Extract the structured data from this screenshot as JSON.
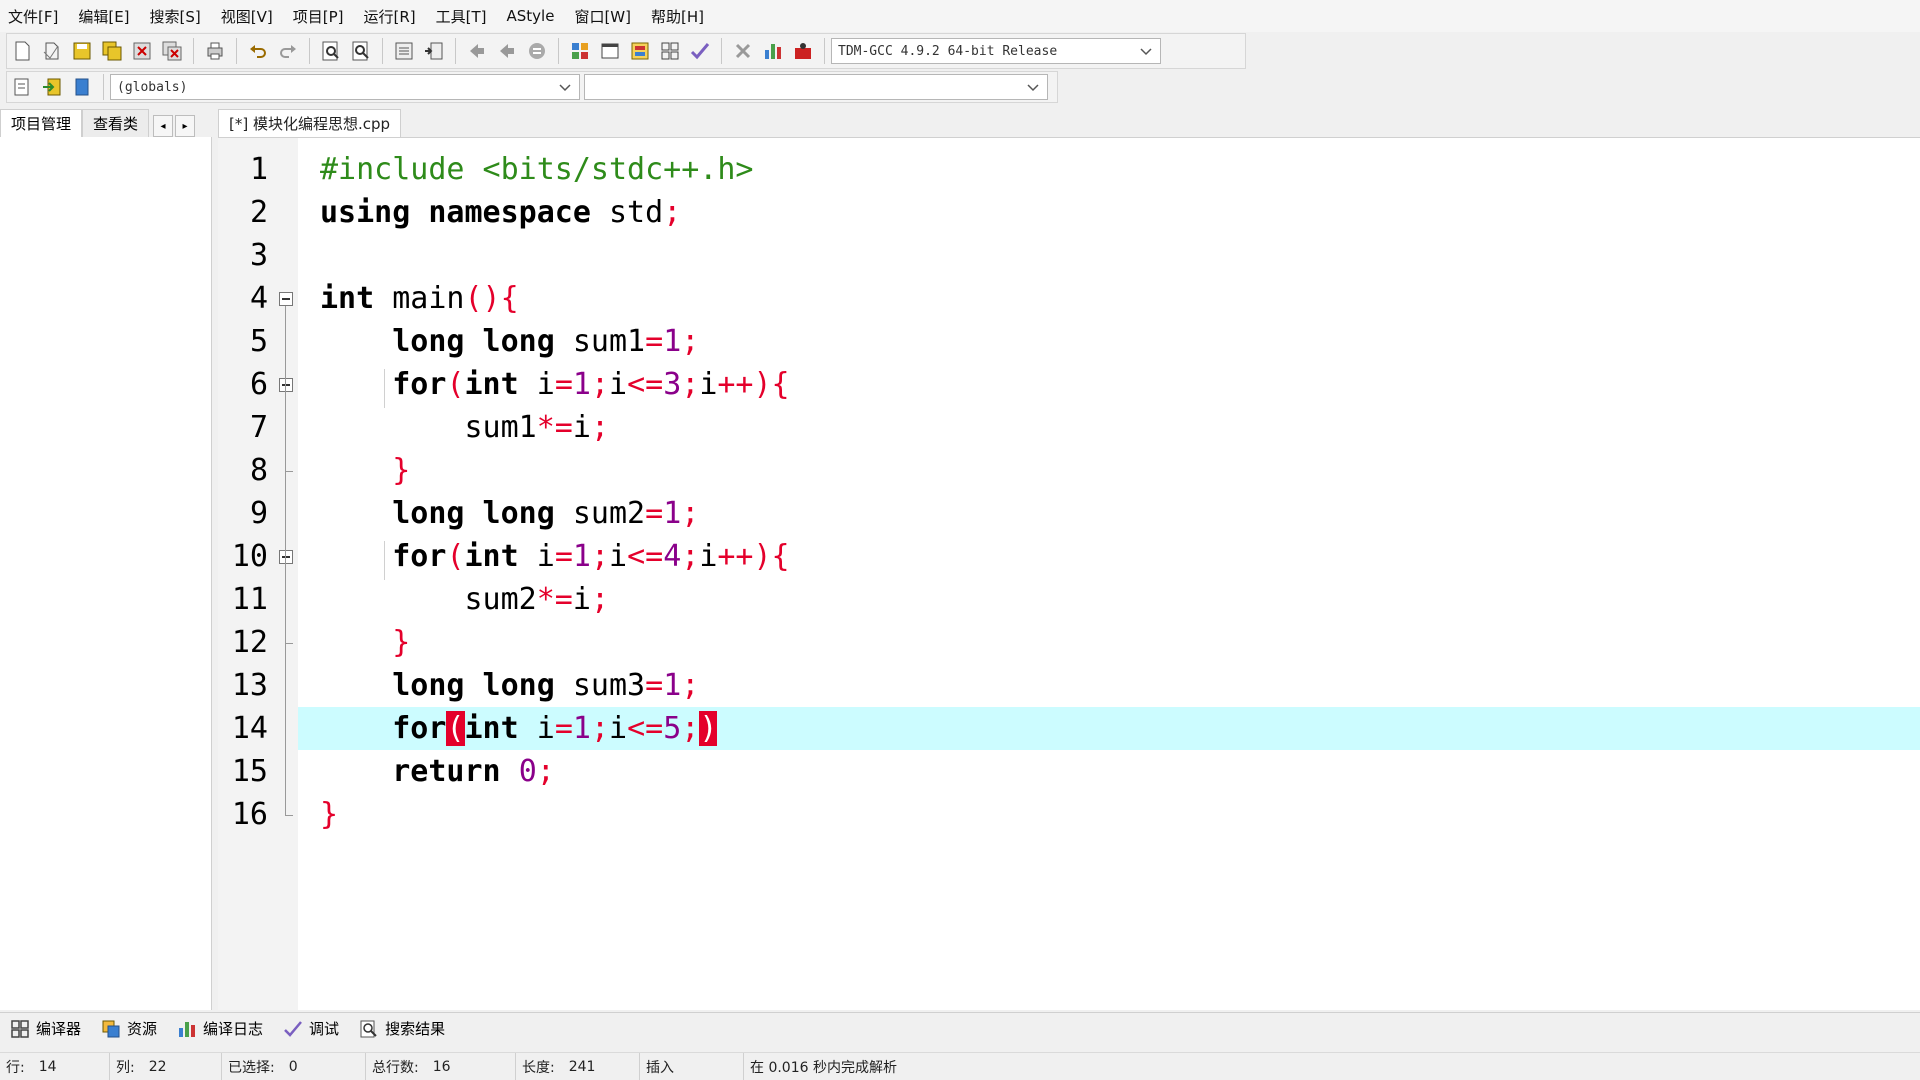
{
  "menubar": [
    "文件[F]",
    "编辑[E]",
    "搜索[S]",
    "视图[V]",
    "项目[P]",
    "运行[R]",
    "工具[T]",
    "AStyle",
    "窗口[W]",
    "帮助[H]"
  ],
  "toolbar": {
    "compiler": "TDM-GCC 4.9.2 64-bit Release",
    "scope": "(globals)",
    "symbol": ""
  },
  "left_panel": {
    "tabs": [
      "项目管理",
      "查看类"
    ]
  },
  "editor": {
    "tab_title": "[*] 模块化编程思想.cpp",
    "lines": [
      {
        "n": "1",
        "tokens": [
          [
            "pp",
            "#include <bits/stdc++.h>"
          ]
        ]
      },
      {
        "n": "2",
        "tokens": [
          [
            "kw",
            "using namespace"
          ],
          [
            "id",
            " std"
          ],
          [
            "sym",
            ";"
          ]
        ]
      },
      {
        "n": "3",
        "tokens": []
      },
      {
        "n": "4",
        "tokens": [
          [
            "kw",
            "int"
          ],
          [
            "id",
            " main"
          ],
          [
            "sym",
            "(){"
          ]
        ]
      },
      {
        "n": "5",
        "tokens": [
          [
            "id",
            "    "
          ],
          [
            "kw",
            "long long"
          ],
          [
            "id",
            " sum1"
          ],
          [
            "sym",
            "="
          ],
          [
            "num",
            "1"
          ],
          [
            "sym",
            ";"
          ]
        ]
      },
      {
        "n": "6",
        "tokens": [
          [
            "id",
            "    "
          ],
          [
            "kw",
            "for"
          ],
          [
            "sym",
            "("
          ],
          [
            "kw",
            "int"
          ],
          [
            "id",
            " i"
          ],
          [
            "sym",
            "="
          ],
          [
            "num",
            "1"
          ],
          [
            "sym",
            ";"
          ],
          [
            "id",
            "i"
          ],
          [
            "sym",
            "<="
          ],
          [
            "num",
            "3"
          ],
          [
            "sym",
            ";"
          ],
          [
            "id",
            "i"
          ],
          [
            "sym",
            "++){"
          ]
        ]
      },
      {
        "n": "7",
        "tokens": [
          [
            "id",
            "        sum1"
          ],
          [
            "sym",
            "*="
          ],
          [
            "id",
            "i"
          ],
          [
            "sym",
            ";"
          ]
        ]
      },
      {
        "n": "8",
        "tokens": [
          [
            "id",
            "    "
          ],
          [
            "sym",
            "}"
          ]
        ]
      },
      {
        "n": "9",
        "tokens": [
          [
            "id",
            "    "
          ],
          [
            "kw",
            "long long"
          ],
          [
            "id",
            " sum2"
          ],
          [
            "sym",
            "="
          ],
          [
            "num",
            "1"
          ],
          [
            "sym",
            ";"
          ]
        ]
      },
      {
        "n": "10",
        "tokens": [
          [
            "id",
            "    "
          ],
          [
            "kw",
            "for"
          ],
          [
            "sym",
            "("
          ],
          [
            "kw",
            "int"
          ],
          [
            "id",
            " i"
          ],
          [
            "sym",
            "="
          ],
          [
            "num",
            "1"
          ],
          [
            "sym",
            ";"
          ],
          [
            "id",
            "i"
          ],
          [
            "sym",
            "<="
          ],
          [
            "num",
            "4"
          ],
          [
            "sym",
            ";"
          ],
          [
            "id",
            "i"
          ],
          [
            "sym",
            "++){"
          ]
        ]
      },
      {
        "n": "11",
        "tokens": [
          [
            "id",
            "        sum2"
          ],
          [
            "sym",
            "*="
          ],
          [
            "id",
            "i"
          ],
          [
            "sym",
            ";"
          ]
        ]
      },
      {
        "n": "12",
        "tokens": [
          [
            "id",
            "    "
          ],
          [
            "sym",
            "}"
          ]
        ]
      },
      {
        "n": "13",
        "tokens": [
          [
            "id",
            "    "
          ],
          [
            "kw",
            "long long"
          ],
          [
            "id",
            " sum3"
          ],
          [
            "sym",
            "="
          ],
          [
            "num",
            "1"
          ],
          [
            "sym",
            ";"
          ]
        ]
      },
      {
        "n": "14",
        "tokens": [
          [
            "id",
            "    "
          ],
          [
            "kw",
            "for"
          ],
          [
            "brk",
            "("
          ],
          [
            "kw",
            "int"
          ],
          [
            "id",
            " i"
          ],
          [
            "sym",
            "="
          ],
          [
            "num",
            "1"
          ],
          [
            "sym",
            ";"
          ],
          [
            "id",
            "i"
          ],
          [
            "sym",
            "<="
          ],
          [
            "num",
            "5"
          ],
          [
            "sym",
            ";"
          ],
          [
            "brk",
            ")"
          ]
        ]
      },
      {
        "n": "15",
        "tokens": [
          [
            "id",
            "    "
          ],
          [
            "kw",
            "return"
          ],
          [
            "id",
            " "
          ],
          [
            "num",
            "0"
          ],
          [
            "sym",
            ";"
          ]
        ]
      },
      {
        "n": "16",
        "tokens": [
          [
            "sym",
            "}"
          ]
        ]
      }
    ],
    "current_line": 14
  },
  "bottom_tabs": [
    {
      "label": "编译器",
      "icon": "compiler-grid-icon"
    },
    {
      "label": "资源",
      "icon": "resources-icon"
    },
    {
      "label": "编译日志",
      "icon": "bar-chart-icon"
    },
    {
      "label": "调试",
      "icon": "check-icon"
    },
    {
      "label": "搜索结果",
      "icon": "search-doc-icon"
    }
  ],
  "status": {
    "row_label": "行:",
    "row": "14",
    "col_label": "列:",
    "col": "22",
    "sel_label": "已选择:",
    "sel": "0",
    "total_label": "总行数:",
    "total": "16",
    "len_label": "长度:",
    "len": "241",
    "mode": "插入",
    "parse": "在 0.016 秒内完成解析"
  },
  "colors": {
    "keyword": "#000000",
    "preprocessor": "#2e8b1a",
    "symbol": "#e4002b",
    "number": "#8a008a",
    "current_line": "#ccfcff"
  }
}
